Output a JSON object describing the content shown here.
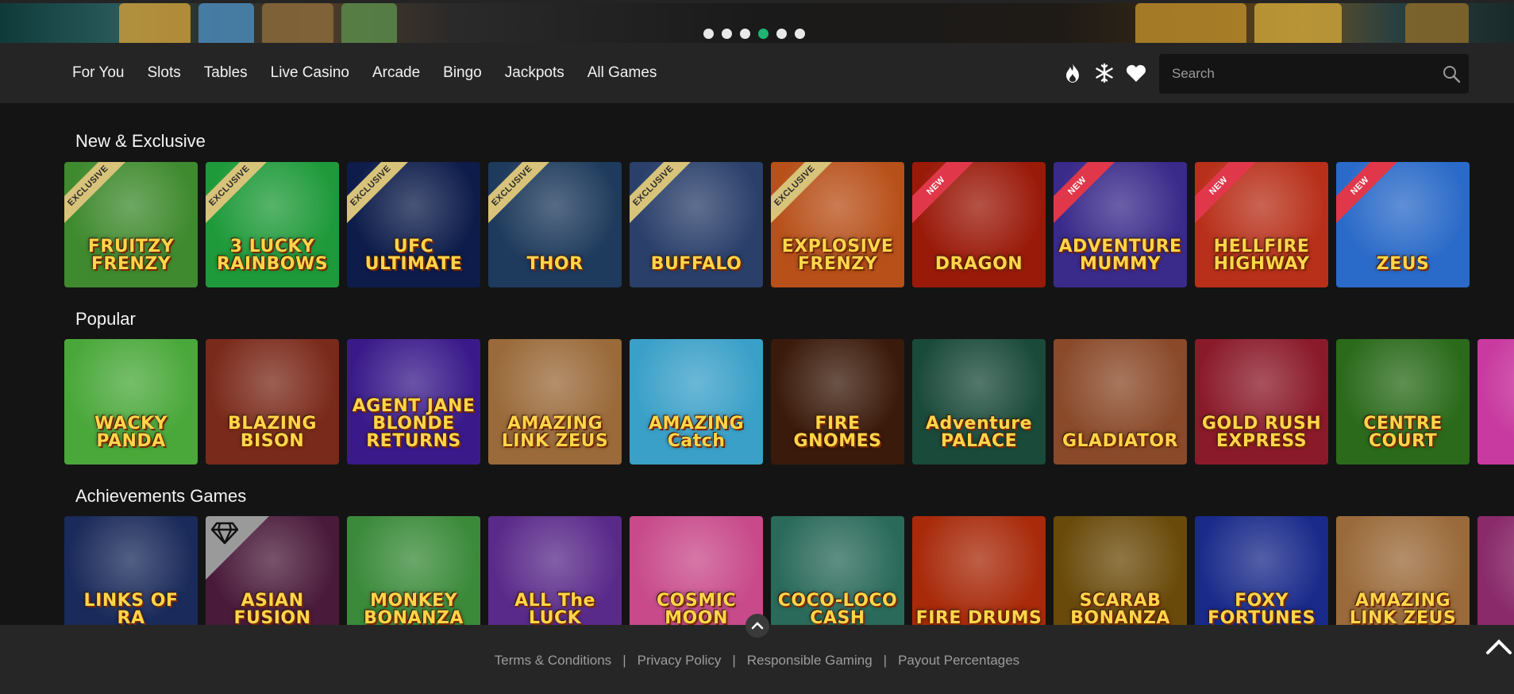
{
  "banner": {
    "slides": 6,
    "active_slide": 4
  },
  "nav": {
    "links": [
      "For You",
      "Slots",
      "Tables",
      "Live Casino",
      "Arcade",
      "Bingo",
      "Jackpots",
      "All Games"
    ],
    "icons": [
      "fire-icon",
      "snowflake-icon",
      "heart-icon"
    ],
    "search_placeholder": "Search"
  },
  "sections": [
    {
      "title": "New & Exclusive",
      "games": [
        {
          "name": "FRUITZY FRENZY",
          "ribbon": "EXCLUSIVE",
          "bg": "#3f8a2e"
        },
        {
          "name": "3 LUCKY RAINBOWS",
          "ribbon": "EXCLUSIVE",
          "bg": "#1f9a3a"
        },
        {
          "name": "UFC ULTIMATE",
          "ribbon": "EXCLUSIVE",
          "bg": "#0d1c4a"
        },
        {
          "name": "THOR",
          "ribbon": "EXCLUSIVE",
          "bg": "#1e3a5c"
        },
        {
          "name": "BUFFALO",
          "ribbon": "EXCLUSIVE",
          "bg": "#2a3f6a"
        },
        {
          "name": "EXPLOSIVE FRENZY",
          "ribbon": "EXCLUSIVE",
          "bg": "#b8501a"
        },
        {
          "name": "DRAGON",
          "ribbon": "NEW",
          "bg": "#9a1a0a"
        },
        {
          "name": "ADVENTURE MUMMY",
          "ribbon": "NEW",
          "bg": "#3a2a8a"
        },
        {
          "name": "HELLFIRE HIGHWAY",
          "ribbon": "NEW",
          "bg": "#b8301a"
        },
        {
          "name": "ZEUS",
          "ribbon": "NEW",
          "bg": "#2a6ac8"
        }
      ]
    },
    {
      "title": "Popular",
      "games": [
        {
          "name": "WACKY PANDA",
          "bg": "#4aa83a"
        },
        {
          "name": "BLAZING BISON",
          "bg": "#7a2a1a"
        },
        {
          "name": "AGENT JANE BLONDE RETURNS",
          "bg": "#3a1a8a"
        },
        {
          "name": "AMAZING LINK ZEUS",
          "bg": "#9a6a3a"
        },
        {
          "name": "AMAZING Catch",
          "bg": "#3aa0c8"
        },
        {
          "name": "FIRE GNOMES",
          "bg": "#3a1a0a"
        },
        {
          "name": "Adventure PALACE",
          "bg": "#1a4a3a"
        },
        {
          "name": "GLADIATOR",
          "bg": "#8a4a2a"
        },
        {
          "name": "GOLD RUSH EXPRESS",
          "bg": "#8a1a2a"
        },
        {
          "name": "CENTRE COURT",
          "bg": "#2a6a1a"
        },
        {
          "name": "",
          "bg": "#c83aa0"
        }
      ]
    },
    {
      "title": "Achievements Games",
      "games": [
        {
          "name": "LINKS OF RA",
          "bg": "#1a2a5a"
        },
        {
          "name": "ASIAN FUSION",
          "bg": "#4a1a3a",
          "gem": true
        },
        {
          "name": "MONKEY BONANZA",
          "bg": "#3a8a3a"
        },
        {
          "name": "ALL The LUCK",
          "bg": "#5a2a8a"
        },
        {
          "name": "COSMIC MOON",
          "bg": "#c84a8a"
        },
        {
          "name": "COCO-LOCO CASH",
          "bg": "#2a6a5a"
        },
        {
          "name": "FIRE DRUMS",
          "bg": "#a82a0a"
        },
        {
          "name": "SCARAB BONANZA",
          "bg": "#6a4a0a"
        },
        {
          "name": "FOXY FORTUNES",
          "bg": "#1a2a8a"
        },
        {
          "name": "AMAZING LINK ZEUS",
          "bg": "#9a6a3a"
        },
        {
          "name": "",
          "bg": "#8a2a6a"
        }
      ]
    }
  ],
  "footer": {
    "links": [
      "Terms & Conditions",
      "Privacy Policy",
      "Responsible Gaming",
      "Payout Percentages"
    ],
    "separator": "|"
  },
  "colors": {
    "accent": "#1fb572",
    "nav_bg": "#252525",
    "page_bg": "#141414",
    "new_ribbon": "#e0384a",
    "exclusive_ribbon": "#d7c37a"
  }
}
